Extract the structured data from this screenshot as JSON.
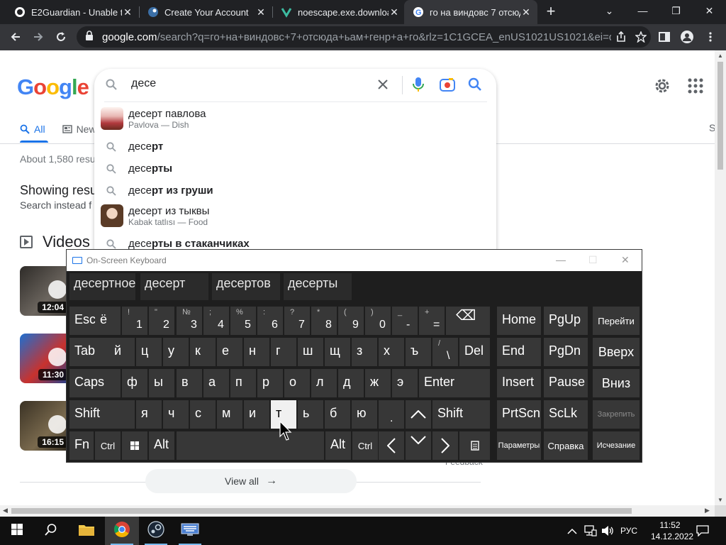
{
  "browser": {
    "tabs": [
      {
        "title": "E2Guardian - Unable to",
        "icon": "e2guardian-favicon"
      },
      {
        "title": "Create Your Account",
        "icon": "steam-favicon"
      },
      {
        "title": "noescape.exe.download",
        "icon": "virustotal-favicon"
      },
      {
        "title": "го на виндовс 7 отсюд",
        "icon": "google-favicon",
        "active": true
      }
    ],
    "url_host": "google.com",
    "url_rest": "/search?q=го+на+виндовс+7+отсюда+ьам+генр+а+го&rlz=1C1GCEA_enUS1021US1021&ei=d8S..."
  },
  "google": {
    "logo_letters": [
      "G",
      "o",
      "o",
      "g",
      "l",
      "e"
    ],
    "logo_colors": [
      "#4285f4",
      "#ea4335",
      "#fbbc05",
      "#4285f4",
      "#34a853",
      "#ea4335"
    ],
    "nav_tabs": [
      {
        "label": "All",
        "icon": "search-icon",
        "active": true
      },
      {
        "label": "New",
        "icon": "news-icon"
      }
    ],
    "nav_right": "S",
    "result_stats": "About 1,580 resu",
    "showing_results": "Showing resu",
    "search_instead": "Search instead f",
    "videos_heading": "Videos",
    "videos": [
      {
        "duration": "12:04"
      },
      {
        "duration": "11:30"
      },
      {
        "duration": "16:15"
      }
    ],
    "feedback": "Feedback",
    "view_all": "View all"
  },
  "search": {
    "query": "десе",
    "suggestions": [
      {
        "typed": "",
        "rest": "десерт павлова",
        "sub": "Pavlova — Dish",
        "thumb": true
      },
      {
        "typed": "десе",
        "rest": "рт"
      },
      {
        "typed": "десе",
        "rest": "рты"
      },
      {
        "typed": "десе",
        "rest": "рт из груши"
      },
      {
        "typed": "",
        "rest": "десерт из тыквы",
        "sub": "Kabak tatlısı — Food",
        "thumb": true
      },
      {
        "typed": "десе",
        "rest": "рты в стаканчиках"
      }
    ]
  },
  "osk": {
    "title": "On-Screen Keyboard",
    "predictions": [
      "десертное",
      "десерт",
      "десертов",
      "десерты"
    ],
    "keys": {
      "esc": "Esc",
      "yo": "ё",
      "n1": "1",
      "s1": "!",
      "n2": "2",
      "s2": "\"",
      "n3": "3",
      "s3": "№",
      "n4": "4",
      "s4": ";",
      "n5": "5",
      "s5": "%",
      "n6": "6",
      "s6": ":",
      "n7": "7",
      "s7": "?",
      "n8": "8",
      "s8": "*",
      "n9": "9",
      "s9": "(",
      "n0": "0",
      "s0": ")",
      "minus": "-",
      "sminus": "_",
      "eq": "=",
      "seq": "+",
      "bksp": "⌫",
      "home": "Home",
      "pgup": "PgUp",
      "go": "Перейти",
      "tab": "Tab",
      "r2": [
        "й",
        "ц",
        "у",
        "к",
        "е",
        "н",
        "г",
        "ш",
        "щ",
        "з",
        "х",
        "ъ"
      ],
      "bslash": "\\",
      "sbslash": "/",
      "del": "Del",
      "end": "End",
      "pgdn": "PgDn",
      "up": "Вверх",
      "caps": "Caps",
      "r3": [
        "ф",
        "ы",
        "в",
        "а",
        "п",
        "р",
        "о",
        "л",
        "д",
        "ж",
        "э"
      ],
      "enter": "Enter",
      "insert": "Insert",
      "pause": "Pause",
      "down": "Вниз",
      "shift": "Shift",
      "r4": [
        "я",
        "ч",
        "с",
        "м",
        "и",
        "т",
        "ь",
        "б",
        "ю"
      ],
      "dot": ".",
      "shift2": "Shift",
      "prtscn": "PrtScn",
      "scrlk": "ScLk",
      "dock": "Закрепить",
      "fn": "Fn",
      "ctrl": "Ctrl",
      "alt": "Alt",
      "alt2": "Alt",
      "ctrl2": "Ctrl",
      "options": "Параметры",
      "help": "Справка",
      "fade": "Исчезание"
    }
  },
  "taskbar": {
    "lang": "РУС",
    "time": "11:52",
    "date": "14.12.2022"
  }
}
